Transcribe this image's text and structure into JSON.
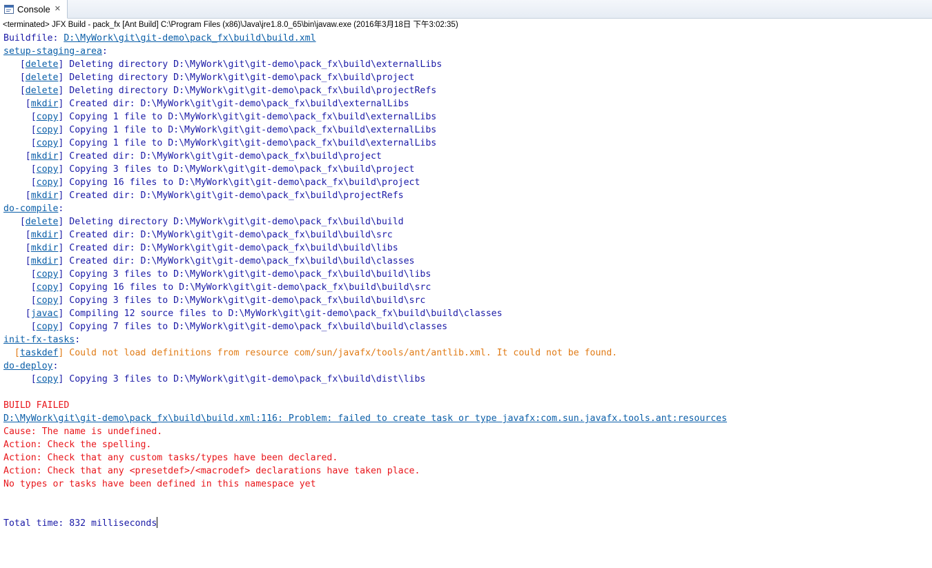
{
  "tab": {
    "label": "Console",
    "close_glyph": "✕",
    "icon": "console-icon"
  },
  "process_info": "<terminated> JFX Build - pack_fx [Ant Build] C:\\Program Files (x86)\\Java\\jre1.8.0_65\\bin\\javaw.exe (2016年3月18日 下午3:02:35)",
  "colors": {
    "output": "#1a1aa6",
    "link": "#0a5ea8",
    "warning": "#e07b16",
    "error": "#e8161b"
  },
  "console": {
    "lines": [
      [
        {
          "t": "Buildfile: ",
          "c": "task"
        },
        {
          "t": "D:\\MyWork\\git\\git-demo\\pack_fx\\build\\build.xml",
          "c": "link"
        }
      ],
      [
        {
          "t": "setup-staging-area",
          "c": "link"
        },
        {
          "t": ":",
          "c": "task"
        }
      ],
      [
        {
          "t": "   [",
          "c": "task"
        },
        {
          "t": "delete",
          "c": "link"
        },
        {
          "t": "] Deleting directory D:\\MyWork\\git\\git-demo\\pack_fx\\build\\externalLibs",
          "c": "task"
        }
      ],
      [
        {
          "t": "   [",
          "c": "task"
        },
        {
          "t": "delete",
          "c": "link"
        },
        {
          "t": "] Deleting directory D:\\MyWork\\git\\git-demo\\pack_fx\\build\\project",
          "c": "task"
        }
      ],
      [
        {
          "t": "   [",
          "c": "task"
        },
        {
          "t": "delete",
          "c": "link"
        },
        {
          "t": "] Deleting directory D:\\MyWork\\git\\git-demo\\pack_fx\\build\\projectRefs",
          "c": "task"
        }
      ],
      [
        {
          "t": "    [",
          "c": "task"
        },
        {
          "t": "mkdir",
          "c": "link"
        },
        {
          "t": "] Created dir: D:\\MyWork\\git\\git-demo\\pack_fx\\build\\externalLibs",
          "c": "task"
        }
      ],
      [
        {
          "t": "     [",
          "c": "task"
        },
        {
          "t": "copy",
          "c": "link"
        },
        {
          "t": "] Copying 1 file to D:\\MyWork\\git\\git-demo\\pack_fx\\build\\externalLibs",
          "c": "task"
        }
      ],
      [
        {
          "t": "     [",
          "c": "task"
        },
        {
          "t": "copy",
          "c": "link"
        },
        {
          "t": "] Copying 1 file to D:\\MyWork\\git\\git-demo\\pack_fx\\build\\externalLibs",
          "c": "task"
        }
      ],
      [
        {
          "t": "     [",
          "c": "task"
        },
        {
          "t": "copy",
          "c": "link"
        },
        {
          "t": "] Copying 1 file to D:\\MyWork\\git\\git-demo\\pack_fx\\build\\externalLibs",
          "c": "task"
        }
      ],
      [
        {
          "t": "    [",
          "c": "task"
        },
        {
          "t": "mkdir",
          "c": "link"
        },
        {
          "t": "] Created dir: D:\\MyWork\\git\\git-demo\\pack_fx\\build\\project",
          "c": "task"
        }
      ],
      [
        {
          "t": "     [",
          "c": "task"
        },
        {
          "t": "copy",
          "c": "link"
        },
        {
          "t": "] Copying 3 files to D:\\MyWork\\git\\git-demo\\pack_fx\\build\\project",
          "c": "task"
        }
      ],
      [
        {
          "t": "     [",
          "c": "task"
        },
        {
          "t": "copy",
          "c": "link"
        },
        {
          "t": "] Copying 16 files to D:\\MyWork\\git\\git-demo\\pack_fx\\build\\project",
          "c": "task"
        }
      ],
      [
        {
          "t": "    [",
          "c": "task"
        },
        {
          "t": "mkdir",
          "c": "link"
        },
        {
          "t": "] Created dir: D:\\MyWork\\git\\git-demo\\pack_fx\\build\\projectRefs",
          "c": "task"
        }
      ],
      [
        {
          "t": "do-compile",
          "c": "link"
        },
        {
          "t": ":",
          "c": "task"
        }
      ],
      [
        {
          "t": "   [",
          "c": "task"
        },
        {
          "t": "delete",
          "c": "link"
        },
        {
          "t": "] Deleting directory D:\\MyWork\\git\\git-demo\\pack_fx\\build\\build",
          "c": "task"
        }
      ],
      [
        {
          "t": "    [",
          "c": "task"
        },
        {
          "t": "mkdir",
          "c": "link"
        },
        {
          "t": "] Created dir: D:\\MyWork\\git\\git-demo\\pack_fx\\build\\build\\src",
          "c": "task"
        }
      ],
      [
        {
          "t": "    [",
          "c": "task"
        },
        {
          "t": "mkdir",
          "c": "link"
        },
        {
          "t": "] Created dir: D:\\MyWork\\git\\git-demo\\pack_fx\\build\\build\\libs",
          "c": "task"
        }
      ],
      [
        {
          "t": "    [",
          "c": "task"
        },
        {
          "t": "mkdir",
          "c": "link"
        },
        {
          "t": "] Created dir: D:\\MyWork\\git\\git-demo\\pack_fx\\build\\build\\classes",
          "c": "task"
        }
      ],
      [
        {
          "t": "     [",
          "c": "task"
        },
        {
          "t": "copy",
          "c": "link"
        },
        {
          "t": "] Copying 3 files to D:\\MyWork\\git\\git-demo\\pack_fx\\build\\build\\libs",
          "c": "task"
        }
      ],
      [
        {
          "t": "     [",
          "c": "task"
        },
        {
          "t": "copy",
          "c": "link"
        },
        {
          "t": "] Copying 16 files to D:\\MyWork\\git\\git-demo\\pack_fx\\build\\build\\src",
          "c": "task"
        }
      ],
      [
        {
          "t": "     [",
          "c": "task"
        },
        {
          "t": "copy",
          "c": "link"
        },
        {
          "t": "] Copying 3 files to D:\\MyWork\\git\\git-demo\\pack_fx\\build\\build\\src",
          "c": "task"
        }
      ],
      [
        {
          "t": "    [",
          "c": "task"
        },
        {
          "t": "javac",
          "c": "link"
        },
        {
          "t": "] Compiling 12 source files to D:\\MyWork\\git\\git-demo\\pack_fx\\build\\build\\classes",
          "c": "task"
        }
      ],
      [
        {
          "t": "     [",
          "c": "task"
        },
        {
          "t": "copy",
          "c": "link"
        },
        {
          "t": "] Copying 7 files to D:\\MyWork\\git\\git-demo\\pack_fx\\build\\build\\classes",
          "c": "task"
        }
      ],
      [
        {
          "t": "init-fx-tasks",
          "c": "link"
        },
        {
          "t": ":",
          "c": "task"
        }
      ],
      [
        {
          "t": "  [",
          "c": "warn"
        },
        {
          "t": "taskdef",
          "c": "link"
        },
        {
          "t": "] Could not load definitions from resource com/sun/javafx/tools/ant/antlib.xml. It could not be found.",
          "c": "warn"
        }
      ],
      [
        {
          "t": "do-deploy",
          "c": "link"
        },
        {
          "t": ":",
          "c": "task"
        }
      ],
      [
        {
          "t": "     [",
          "c": "task"
        },
        {
          "t": "copy",
          "c": "link"
        },
        {
          "t": "] Copying 3 files to D:\\MyWork\\git\\git-demo\\pack_fx\\build\\dist\\libs",
          "c": "task"
        }
      ],
      [],
      [
        {
          "t": "BUILD FAILED",
          "c": "err"
        }
      ],
      [
        {
          "t": "D:\\MyWork\\git\\git-demo\\pack_fx\\build\\build.xml:116: Problem: failed to create task or type javafx:com.sun.javafx.tools.ant:resources",
          "c": "link"
        }
      ],
      [
        {
          "t": "Cause: The name is undefined.",
          "c": "err"
        }
      ],
      [
        {
          "t": "Action: Check the spelling.",
          "c": "err"
        }
      ],
      [
        {
          "t": "Action: Check that any custom tasks/types have been declared.",
          "c": "err"
        }
      ],
      [
        {
          "t": "Action: Check that any <presetdef>/<macrodef> declarations have taken place.",
          "c": "err"
        }
      ],
      [
        {
          "t": "No types or tasks have been defined in this namespace yet",
          "c": "err"
        }
      ],
      [],
      [],
      [
        {
          "t": "Total time: 832 milliseconds",
          "c": "task"
        }
      ]
    ]
  }
}
